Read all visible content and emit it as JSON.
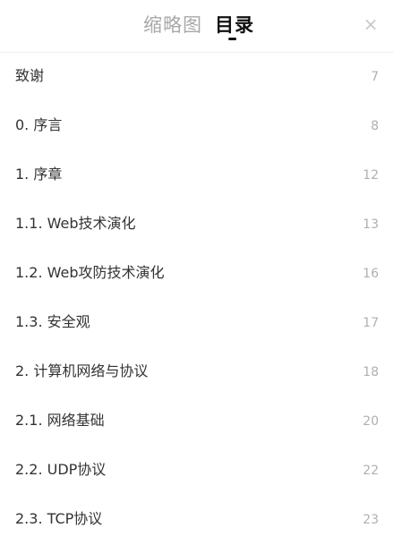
{
  "header": {
    "tabs": [
      {
        "label": "缩略图",
        "active": false
      },
      {
        "label": "目录",
        "active": true
      }
    ],
    "close_icon": "close-icon",
    "close_glyph": "×"
  },
  "colors": {
    "active_tab": "#111111",
    "inactive_tab": "#a8a8a8",
    "page_number": "#b0b0b0",
    "item_text": "#333333"
  },
  "toc": {
    "items": [
      {
        "title": "致谢",
        "page": "7"
      },
      {
        "title": "0. 序言",
        "page": "8"
      },
      {
        "title": "1. 序章",
        "page": "12"
      },
      {
        "title": "1.1. Web技术演化",
        "page": "13"
      },
      {
        "title": "1.2. Web攻防技术演化",
        "page": "16"
      },
      {
        "title": "1.3. 安全观",
        "page": "17"
      },
      {
        "title": "2. 计算机网络与协议",
        "page": "18"
      },
      {
        "title": "2.1. 网络基础",
        "page": "20"
      },
      {
        "title": "2.2. UDP协议",
        "page": "22"
      },
      {
        "title": "2.3. TCP协议",
        "page": "23"
      }
    ]
  }
}
